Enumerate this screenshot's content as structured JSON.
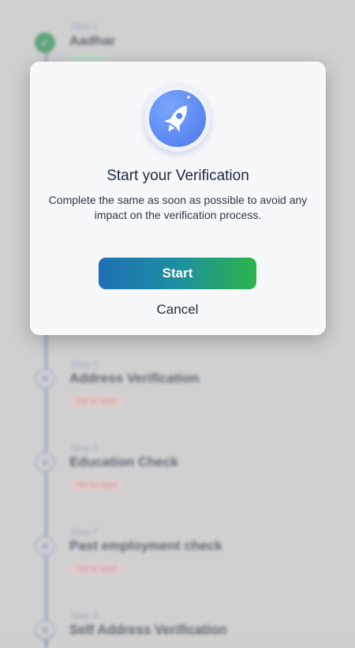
{
  "steps": [
    {
      "number": "Step 1",
      "title": "Aadhar",
      "status": "",
      "state": "done"
    },
    {
      "number": "Step 5",
      "title": "Address Verification",
      "status": "Yet to start",
      "state": "pending"
    },
    {
      "number": "Step 6",
      "title": "Education Check",
      "status": "Yet to start",
      "state": "pending"
    },
    {
      "number": "Step 7",
      "title": "Past employment check",
      "status": "Yet to start",
      "state": "pending"
    },
    {
      "number": "Step 8",
      "title": "Self Address Verification",
      "status": "",
      "state": "pending"
    }
  ],
  "modal": {
    "icon": "rocket-icon",
    "title": "Start your Verification",
    "description": "Complete the same as soon as possible to avoid any impact on the verification process.",
    "start_label": "Start",
    "cancel_label": "Cancel"
  },
  "colors": {
    "button_gradient_start": "#1f6fb4",
    "button_gradient_end": "#2bb44b",
    "icon_blue": "#5b86f0",
    "done_green": "#1c8a4a"
  }
}
